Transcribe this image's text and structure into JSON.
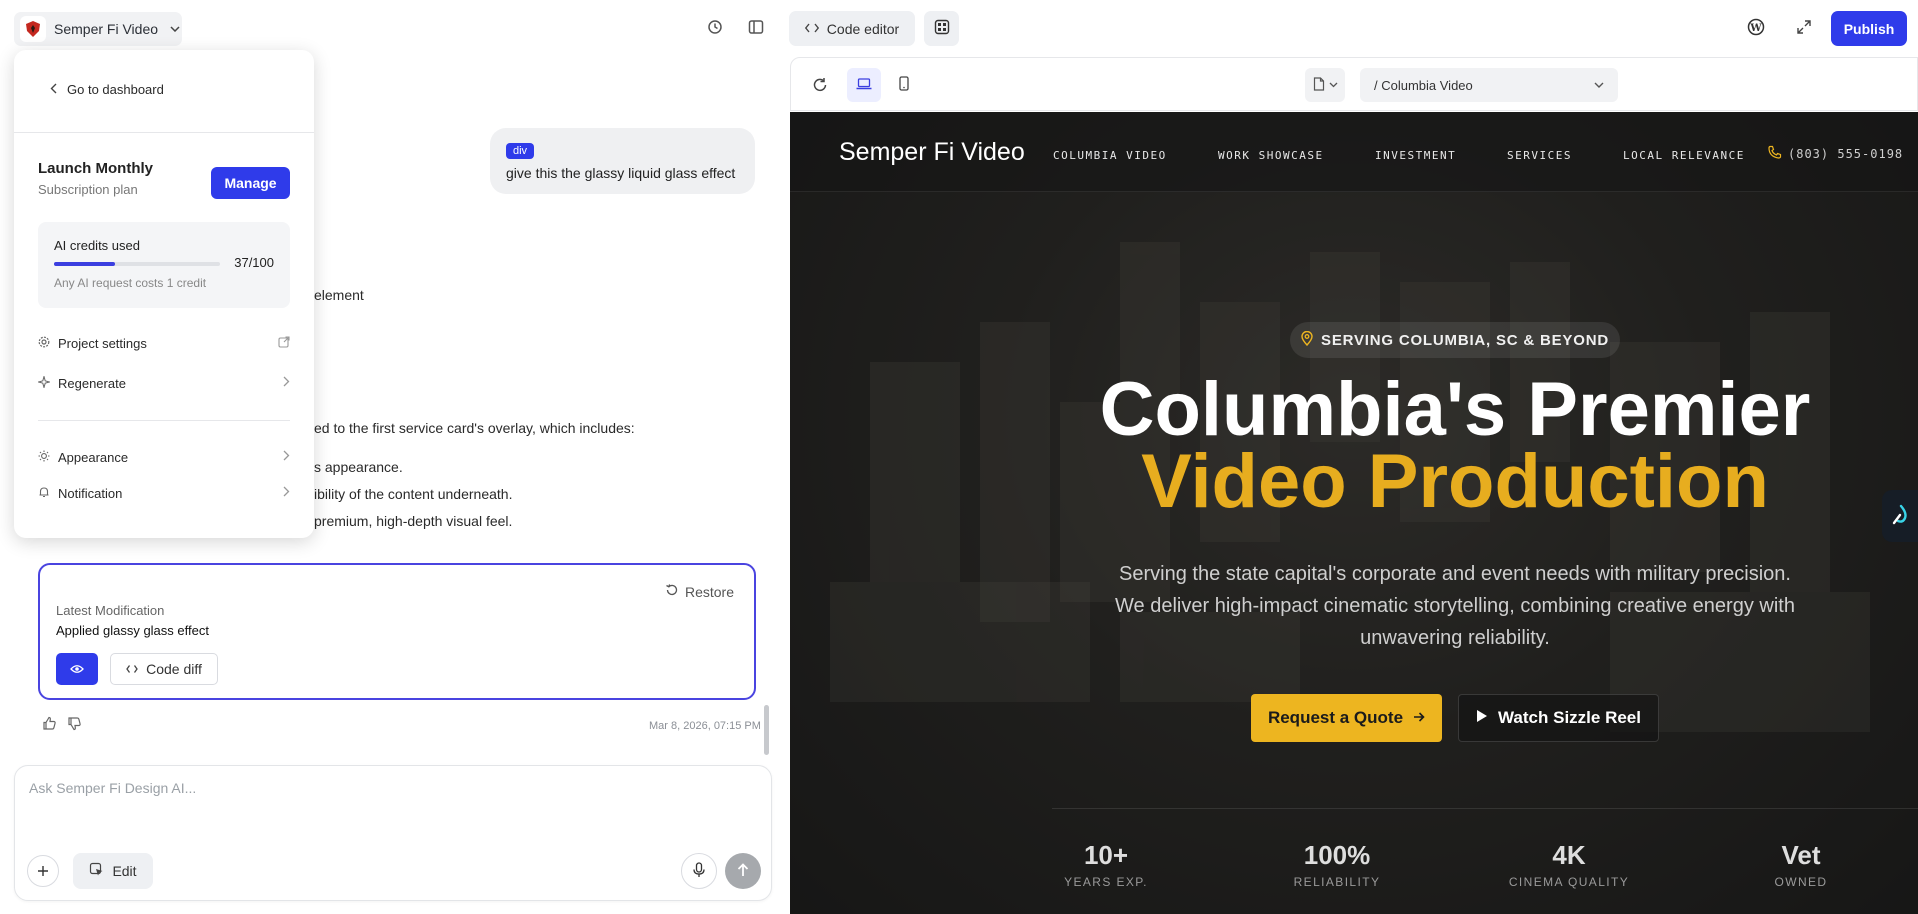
{
  "topbar": {
    "project_name": "Semper Fi Video",
    "code_editor_label": "Code editor",
    "publish_label": "Publish"
  },
  "chat": {
    "user_message": {
      "tag": "div",
      "text": "give this the glassy liquid glass effect"
    },
    "assistant_fragments": [
      "element",
      "ed to the first service card's overlay, which includes:",
      "s appearance.",
      "ibility of the content underneath.",
      "premium, high-depth visual feel."
    ],
    "modification": {
      "restore_label": "Restore",
      "label": "Latest Modification",
      "title": "Applied glassy glass effect",
      "code_diff_label": "Code diff"
    },
    "timestamp": "Mar 8, 2026, 07:15 PM",
    "composer": {
      "placeholder": "Ask Semper Fi Design AI...",
      "edit_label": "Edit"
    }
  },
  "menu": {
    "back_label": "Go to dashboard",
    "plan_name": "Launch Monthly",
    "plan_subtitle": "Subscription plan",
    "manage_label": "Manage",
    "credits": {
      "title": "AI credits used",
      "used": 37,
      "total": 100,
      "count_label": "37/100",
      "note": "Any AI request costs 1 credit"
    },
    "items": [
      {
        "label": "Project settings",
        "icon": "gear-icon",
        "trail": "external-link-icon"
      },
      {
        "label": "Regenerate",
        "icon": "sparkle-icon",
        "trail": "chevron-right-icon"
      },
      {
        "label": "Appearance",
        "icon": "sun-icon",
        "trail": "chevron-right-icon"
      },
      {
        "label": "Notification",
        "icon": "bell-icon",
        "trail": "chevron-right-icon"
      }
    ]
  },
  "preview": {
    "page_path": "/ Columbia Video",
    "site": {
      "logo": "Semper Fi Video",
      "nav": [
        "COLUMBIA VIDEO",
        "WORK SHOWCASE",
        "INVESTMENT",
        "SERVICES",
        "LOCAL RELEVANCE"
      ],
      "phone": "(803) 555-0198",
      "badge": "SERVING COLUMBIA, SC & BEYOND",
      "headline_1": "Columbia's Premier",
      "headline_2": "Video Production",
      "subtext": "Serving the state capital's corporate and event needs with military precision. We deliver high-impact cinematic storytelling, combining creative energy with unwavering reliability.",
      "cta_primary": "Request a Quote",
      "cta_secondary": "Watch Sizzle Reel",
      "stats": [
        {
          "value": "10+",
          "label": "YEARS EXP."
        },
        {
          "value": "100%",
          "label": "RELIABILITY"
        },
        {
          "value": "4K",
          "label": "CINEMA QUALITY"
        },
        {
          "value": "Vet",
          "label": "OWNED"
        }
      ]
    }
  },
  "colors": {
    "accent": "#2f3bea",
    "gold": "#edb520",
    "site_bg": "#1c1c1b"
  }
}
